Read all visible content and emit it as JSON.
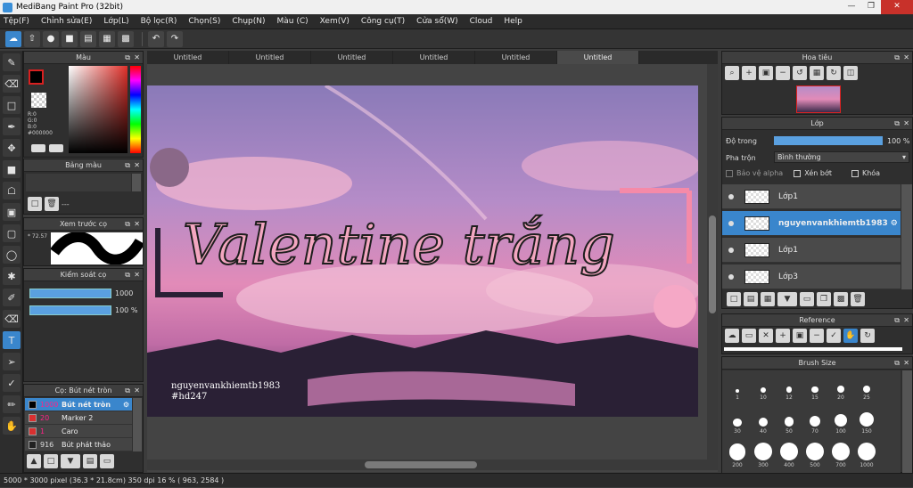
{
  "window": {
    "title": "MediBang Paint Pro (32bit)"
  },
  "menu": [
    "Tệp(F)",
    "Chỉnh sửa(E)",
    "Lớp(L)",
    "Bộ lọc(R)",
    "Chọn(S)",
    "Chụp(N)",
    "Màu (C)",
    "Xem(V)",
    "Công cụ(T)",
    "Cửa sổ(W)",
    "Cloud",
    "Help"
  ],
  "tabs": [
    "Untitled",
    "Untitled",
    "Untitled",
    "Untitled",
    "Untitled",
    "Untitled"
  ],
  "color_panel": {
    "title": "Màu",
    "r": "R:0",
    "g": "G:0",
    "b": "B:0",
    "hex": "#000000"
  },
  "palette_panel": {
    "title": "Bảng màu",
    "value": "---"
  },
  "preview_panel": {
    "title": "Xem trước cọ",
    "size": "72.57"
  },
  "control_panel": {
    "title": "Kiểm soát cọ",
    "size": "1000",
    "opacity": "100 %"
  },
  "brush_list_panel": {
    "title": "Cọ: Bút nét tròn",
    "items": [
      {
        "size": "1000",
        "name": "Bút nét tròn",
        "color": "#000000"
      },
      {
        "size": "20",
        "name": "Marker 2",
        "color": "#d83030"
      },
      {
        "size": "1",
        "name": "Caro",
        "color": "#d83030"
      },
      {
        "size": "916",
        "name": "Bút phát thảo",
        "color": "#222222"
      }
    ]
  },
  "navigator_panel": {
    "title": "Hoa tiêu"
  },
  "layer_panel": {
    "title": "Lớp",
    "opacity_label": "Độ trong",
    "opacity_value": "100 %",
    "blend_label": "Pha trộn",
    "blend_value": "Bình thường",
    "protect_alpha": "Bảo vệ alpha",
    "clip": "Xén bớt",
    "lock": "Khóa",
    "layers": [
      {
        "name": "Lớp1"
      },
      {
        "name": "nguyenvankhiemtb1983"
      },
      {
        "name": "Lớp1"
      },
      {
        "name": "Lớp3"
      }
    ]
  },
  "reference_panel": {
    "title": "Reference"
  },
  "brush_size_panel": {
    "title": "Brush Size",
    "sizes": [
      "1",
      "10",
      "12",
      "15",
      "20",
      "25",
      "30",
      "40",
      "50",
      "70",
      "100",
      "150",
      "200",
      "300",
      "400",
      "500",
      "700",
      "1000"
    ]
  },
  "artwork": {
    "title_text": "Valentine trắng",
    "credit_line1": "nguyenvankhiemtb1983",
    "credit_line2": "#hd247"
  },
  "status": {
    "text": "5000 * 3000 pixel   (36.3 * 21.8cm)  350 dpi  16 %  ( 963, 2584 )"
  }
}
